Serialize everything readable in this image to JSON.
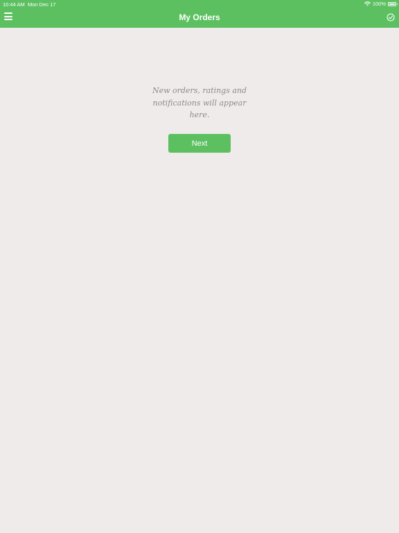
{
  "status_bar": {
    "time": "10:44 AM",
    "date": "Mon Dec 17",
    "battery": "100%",
    "battery_level": 1.0
  },
  "header": {
    "title": "My Orders",
    "menu_icon": "hamburger-menu-icon",
    "right_icon": "checkmark-circle-icon"
  },
  "main": {
    "empty_message_lines": [
      "New orders, ratings and",
      "notifications will appear",
      "here."
    ],
    "next_label": "Next"
  },
  "colors": {
    "accent": "#5cc061",
    "background": "#efebea",
    "message_text": "#8a8a8a"
  }
}
